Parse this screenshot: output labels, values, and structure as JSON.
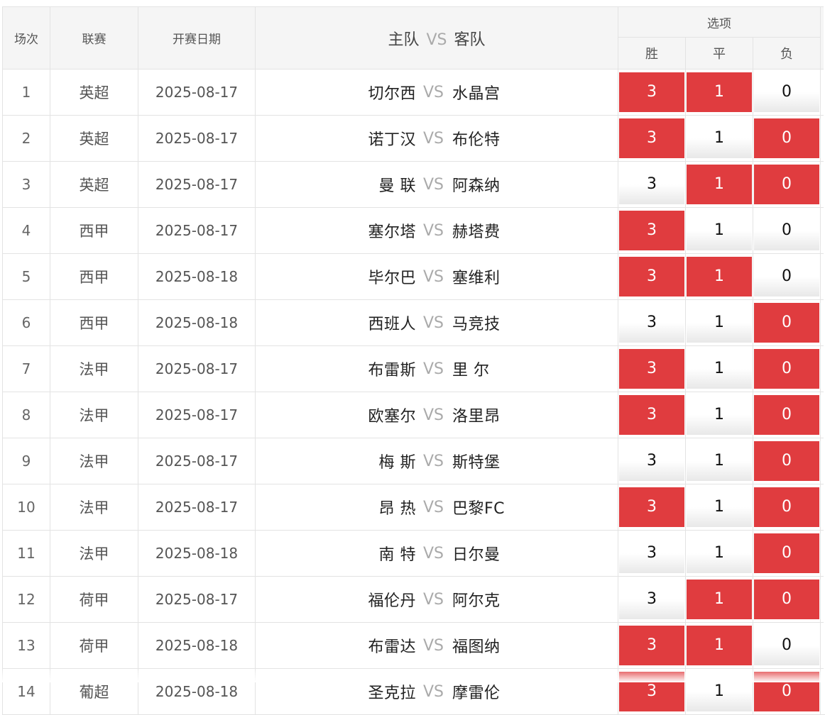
{
  "header": {
    "idx": "场次",
    "league": "联赛",
    "date": "开赛日期",
    "match_home": "主队",
    "match_vs": "VS",
    "match_away": "客队",
    "options": "选项",
    "win": "胜",
    "draw": "平",
    "lose": "负"
  },
  "vs_label": "VS",
  "rows": [
    {
      "idx": "1",
      "league": "英超",
      "date": "2025-08-17",
      "home": "切尔西",
      "away": "水晶宫",
      "win": "3",
      "draw": "1",
      "lose": "0",
      "sel": [
        true,
        true,
        false
      ]
    },
    {
      "idx": "2",
      "league": "英超",
      "date": "2025-08-17",
      "home": "诺丁汉",
      "away": "布伦特",
      "win": "3",
      "draw": "1",
      "lose": "0",
      "sel": [
        true,
        false,
        true
      ]
    },
    {
      "idx": "3",
      "league": "英超",
      "date": "2025-08-17",
      "home": "曼 联",
      "away": "阿森纳",
      "win": "3",
      "draw": "1",
      "lose": "0",
      "sel": [
        false,
        true,
        true
      ]
    },
    {
      "idx": "4",
      "league": "西甲",
      "date": "2025-08-17",
      "home": "塞尔塔",
      "away": "赫塔费",
      "win": "3",
      "draw": "1",
      "lose": "0",
      "sel": [
        true,
        false,
        false
      ]
    },
    {
      "idx": "5",
      "league": "西甲",
      "date": "2025-08-18",
      "home": "毕尔巴",
      "away": "塞维利",
      "win": "3",
      "draw": "1",
      "lose": "0",
      "sel": [
        true,
        true,
        false
      ]
    },
    {
      "idx": "6",
      "league": "西甲",
      "date": "2025-08-18",
      "home": "西班人",
      "away": "马竞技",
      "win": "3",
      "draw": "1",
      "lose": "0",
      "sel": [
        false,
        false,
        true
      ]
    },
    {
      "idx": "7",
      "league": "法甲",
      "date": "2025-08-17",
      "home": "布雷斯",
      "away": "里 尔",
      "win": "3",
      "draw": "1",
      "lose": "0",
      "sel": [
        true,
        false,
        true
      ]
    },
    {
      "idx": "8",
      "league": "法甲",
      "date": "2025-08-17",
      "home": "欧塞尔",
      "away": "洛里昂",
      "win": "3",
      "draw": "1",
      "lose": "0",
      "sel": [
        true,
        false,
        true
      ]
    },
    {
      "idx": "9",
      "league": "法甲",
      "date": "2025-08-17",
      "home": "梅 斯",
      "away": "斯特堡",
      "win": "3",
      "draw": "1",
      "lose": "0",
      "sel": [
        false,
        false,
        true
      ]
    },
    {
      "idx": "10",
      "league": "法甲",
      "date": "2025-08-17",
      "home": "昂 热",
      "away": "巴黎FC",
      "win": "3",
      "draw": "1",
      "lose": "0",
      "sel": [
        true,
        false,
        true
      ]
    },
    {
      "idx": "11",
      "league": "法甲",
      "date": "2025-08-18",
      "home": "南 特",
      "away": "日尔曼",
      "win": "3",
      "draw": "1",
      "lose": "0",
      "sel": [
        false,
        false,
        true
      ]
    },
    {
      "idx": "12",
      "league": "荷甲",
      "date": "2025-08-17",
      "home": "福伦丹",
      "away": "阿尔克",
      "win": "3",
      "draw": "1",
      "lose": "0",
      "sel": [
        false,
        true,
        true
      ]
    },
    {
      "idx": "13",
      "league": "荷甲",
      "date": "2025-08-18",
      "home": "布雷达",
      "away": "福图纳",
      "win": "3",
      "draw": "1",
      "lose": "0",
      "sel": [
        true,
        true,
        false
      ]
    },
    {
      "idx": "14",
      "league": "葡超",
      "date": "2025-08-18",
      "home": "圣克拉",
      "away": "摩雷伦",
      "win": "3",
      "draw": "1",
      "lose": "0",
      "sel": [
        true,
        false,
        true
      ]
    }
  ],
  "colors": {
    "selected_bg": "#e03c3f",
    "header_bg": "#f5f5f5",
    "border": "#e3e3e3"
  }
}
